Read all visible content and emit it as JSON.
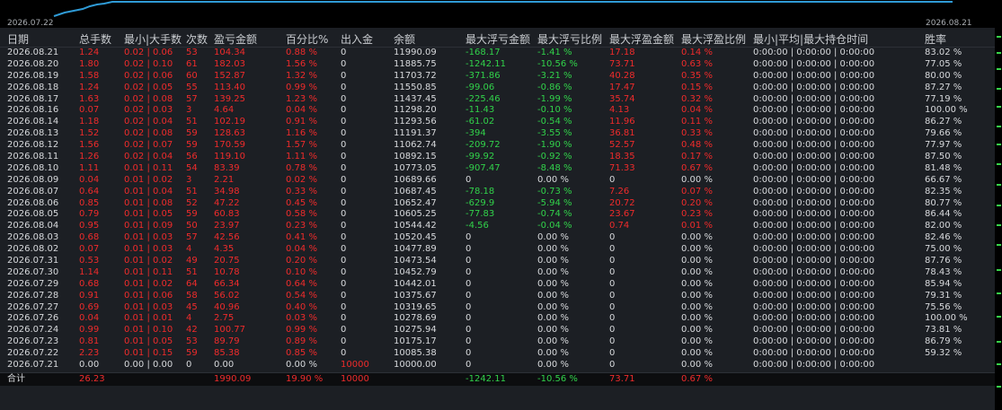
{
  "colors": {
    "background": "#1c1f24",
    "positive_red": "#ef2b2b",
    "negative_green": "#31d24a",
    "equity_line": "#2f9bd6"
  },
  "chart": {
    "start_date": "2026.07.22",
    "end_date": "2026.08.21"
  },
  "headers": [
    "日期",
    "总手数",
    "最小|大手数",
    "次数",
    "盈亏金额",
    "百分比%",
    "出入金",
    "余额",
    "最大浮亏金额",
    "最大浮亏比例",
    "最大浮盈金额",
    "最大浮盈比例",
    "最小|平均|最大持仓时间",
    "胜率"
  ],
  "rows": [
    [
      "2026.08.21",
      "1.24",
      "0.02 | 0.06",
      "53",
      "104.34",
      "0.88 %",
      "0",
      "11990.09",
      "-168.17",
      "-1.41 %",
      "17.18",
      "0.14 %",
      "0:00:00 | 0:00:00 | 0:00:00",
      "83.02 %"
    ],
    [
      "2026.08.20",
      "1.80",
      "0.02 | 0.10",
      "61",
      "182.03",
      "1.56 %",
      "0",
      "11885.75",
      "-1242.11",
      "-10.56 %",
      "73.71",
      "0.63 %",
      "0:00:00 | 0:00:00 | 0:00:00",
      "77.05 %"
    ],
    [
      "2026.08.19",
      "1.58",
      "0.02 | 0.06",
      "60",
      "152.87",
      "1.32 %",
      "0",
      "11703.72",
      "-371.86",
      "-3.21 %",
      "40.28",
      "0.35 %",
      "0:00:00 | 0:00:00 | 0:00:00",
      "80.00 %"
    ],
    [
      "2026.08.18",
      "1.24",
      "0.02 | 0.05",
      "55",
      "113.40",
      "0.99 %",
      "0",
      "11550.85",
      "-99.06",
      "-0.86 %",
      "17.47",
      "0.15 %",
      "0:00:00 | 0:00:00 | 0:00:00",
      "87.27 %"
    ],
    [
      "2026.08.17",
      "1.63",
      "0.02 | 0.08",
      "57",
      "139.25",
      "1.23 %",
      "0",
      "11437.45",
      "-225.46",
      "-1.99 %",
      "35.74",
      "0.32 %",
      "0:00:00 | 0:00:00 | 0:00:00",
      "77.19 %"
    ],
    [
      "2026.08.16",
      "0.07",
      "0.02 | 0.03",
      "3",
      "4.64",
      "0.04 %",
      "0",
      "11298.20",
      "-11.43",
      "-0.10 %",
      "4.13",
      "0.04 %",
      "0:00:00 | 0:00:00 | 0:00:00",
      "100.00 %"
    ],
    [
      "2026.08.14",
      "1.18",
      "0.02 | 0.04",
      "51",
      "102.19",
      "0.91 %",
      "0",
      "11293.56",
      "-61.02",
      "-0.54 %",
      "11.96",
      "0.11 %",
      "0:00:00 | 0:00:00 | 0:00:00",
      "86.27 %"
    ],
    [
      "2026.08.13",
      "1.52",
      "0.02 | 0.08",
      "59",
      "128.63",
      "1.16 %",
      "0",
      "11191.37",
      "-394",
      "-3.55 %",
      "36.81",
      "0.33 %",
      "0:00:00 | 0:00:00 | 0:00:00",
      "79.66 %"
    ],
    [
      "2026.08.12",
      "1.56",
      "0.02 | 0.07",
      "59",
      "170.59",
      "1.57 %",
      "0",
      "11062.74",
      "-209.72",
      "-1.90 %",
      "52.57",
      "0.48 %",
      "0:00:00 | 0:00:00 | 0:00:00",
      "77.97 %"
    ],
    [
      "2026.08.11",
      "1.26",
      "0.02 | 0.04",
      "56",
      "119.10",
      "1.11 %",
      "0",
      "10892.15",
      "-99.92",
      "-0.92 %",
      "18.35",
      "0.17 %",
      "0:00:00 | 0:00:00 | 0:00:00",
      "87.50 %"
    ],
    [
      "2026.08.10",
      "1.11",
      "0.01 | 0.11",
      "54",
      "83.39",
      "0.78 %",
      "0",
      "10773.05",
      "-907.47",
      "-8.48 %",
      "71.33",
      "0.67 %",
      "0:00:00 | 0:00:00 | 0:00:00",
      "81.48 %"
    ],
    [
      "2026.08.09",
      "0.04",
      "0.01 | 0.02",
      "3",
      "2.21",
      "0.02 %",
      "0",
      "10689.66",
      "0",
      "0.00 %",
      "0",
      "0.00 %",
      "0:00:00 | 0:00:00 | 0:00:00",
      "66.67 %"
    ],
    [
      "2026.08.07",
      "0.64",
      "0.01 | 0.04",
      "51",
      "34.98",
      "0.33 %",
      "0",
      "10687.45",
      "-78.18",
      "-0.73 %",
      "7.26",
      "0.07 %",
      "0:00:00 | 0:00:00 | 0:00:00",
      "82.35 %"
    ],
    [
      "2026.08.06",
      "0.85",
      "0.01 | 0.08",
      "52",
      "47.22",
      "0.45 %",
      "0",
      "10652.47",
      "-629.9",
      "-5.94 %",
      "20.72",
      "0.20 %",
      "0:00:00 | 0:00:00 | 0:00:00",
      "80.77 %"
    ],
    [
      "2026.08.05",
      "0.79",
      "0.01 | 0.05",
      "59",
      "60.83",
      "0.58 %",
      "0",
      "10605.25",
      "-77.83",
      "-0.74 %",
      "23.67",
      "0.23 %",
      "0:00:00 | 0:00:00 | 0:00:00",
      "86.44 %"
    ],
    [
      "2026.08.04",
      "0.95",
      "0.01 | 0.09",
      "50",
      "23.97",
      "0.23 %",
      "0",
      "10544.42",
      "-4.56",
      "-0.04 %",
      "0.74",
      "0.01 %",
      "0:00:00 | 0:00:00 | 0:00:00",
      "82.00 %"
    ],
    [
      "2026.08.03",
      "0.68",
      "0.01 | 0.03",
      "57",
      "42.56",
      "0.41 %",
      "0",
      "10520.45",
      "0",
      "0.00 %",
      "0",
      "0.00 %",
      "0:00:00 | 0:00:00 | 0:00:00",
      "82.46 %"
    ],
    [
      "2026.08.02",
      "0.07",
      "0.01 | 0.03",
      "4",
      "4.35",
      "0.04 %",
      "0",
      "10477.89",
      "0",
      "0.00 %",
      "0",
      "0.00 %",
      "0:00:00 | 0:00:00 | 0:00:00",
      "75.00 %"
    ],
    [
      "2026.07.31",
      "0.53",
      "0.01 | 0.02",
      "49",
      "20.75",
      "0.20 %",
      "0",
      "10473.54",
      "0",
      "0.00 %",
      "0",
      "0.00 %",
      "0:00:00 | 0:00:00 | 0:00:00",
      "87.76 %"
    ],
    [
      "2026.07.30",
      "1.14",
      "0.01 | 0.11",
      "51",
      "10.78",
      "0.10 %",
      "0",
      "10452.79",
      "0",
      "0.00 %",
      "0",
      "0.00 %",
      "0:00:00 | 0:00:00 | 0:00:00",
      "78.43 %"
    ],
    [
      "2026.07.29",
      "0.68",
      "0.01 | 0.02",
      "64",
      "66.34",
      "0.64 %",
      "0",
      "10442.01",
      "0",
      "0.00 %",
      "0",
      "0.00 %",
      "0:00:00 | 0:00:00 | 0:00:00",
      "85.94 %"
    ],
    [
      "2026.07.28",
      "0.91",
      "0.01 | 0.06",
      "58",
      "56.02",
      "0.54 %",
      "0",
      "10375.67",
      "0",
      "0.00 %",
      "0",
      "0.00 %",
      "0:00:00 | 0:00:00 | 0:00:00",
      "79.31 %"
    ],
    [
      "2026.07.27",
      "0.69",
      "0.01 | 0.03",
      "45",
      "40.96",
      "0.40 %",
      "0",
      "10319.65",
      "0",
      "0.00 %",
      "0",
      "0.00 %",
      "0:00:00 | 0:00:00 | 0:00:00",
      "75.56 %"
    ],
    [
      "2026.07.26",
      "0.04",
      "0.01 | 0.01",
      "4",
      "2.75",
      "0.03 %",
      "0",
      "10278.69",
      "0",
      "0.00 %",
      "0",
      "0.00 %",
      "0:00:00 | 0:00:00 | 0:00:00",
      "100.00 %"
    ],
    [
      "2026.07.24",
      "0.99",
      "0.01 | 0.10",
      "42",
      "100.77",
      "0.99 %",
      "0",
      "10275.94",
      "0",
      "0.00 %",
      "0",
      "0.00 %",
      "0:00:00 | 0:00:00 | 0:00:00",
      "73.81 %"
    ],
    [
      "2026.07.23",
      "0.81",
      "0.01 | 0.05",
      "53",
      "89.79",
      "0.89 %",
      "0",
      "10175.17",
      "0",
      "0.00 %",
      "0",
      "0.00 %",
      "0:00:00 | 0:00:00 | 0:00:00",
      "86.79 %"
    ],
    [
      "2026.07.22",
      "2.23",
      "0.01 | 0.15",
      "59",
      "85.38",
      "0.85 %",
      "0",
      "10085.38",
      "0",
      "0.00 %",
      "0",
      "0.00 %",
      "0:00:00 | 0:00:00 | 0:00:00",
      "59.32 %"
    ],
    [
      "2026.07.21",
      "0.00",
      "0.00 | 0.00",
      "0",
      "0.00",
      "0.00 %",
      "10000",
      "10000.00",
      "0",
      "0.00 %",
      "0",
      "0.00 %",
      "0:00:00 | 0:00:00 | 0:00:00",
      ""
    ]
  ],
  "total": [
    "合计",
    "26.23",
    "",
    "",
    "1990.09",
    "19.90 %",
    "10000",
    "",
    "-1242.11",
    "-10.56 %",
    "73.71",
    "0.67 %",
    "",
    ""
  ]
}
